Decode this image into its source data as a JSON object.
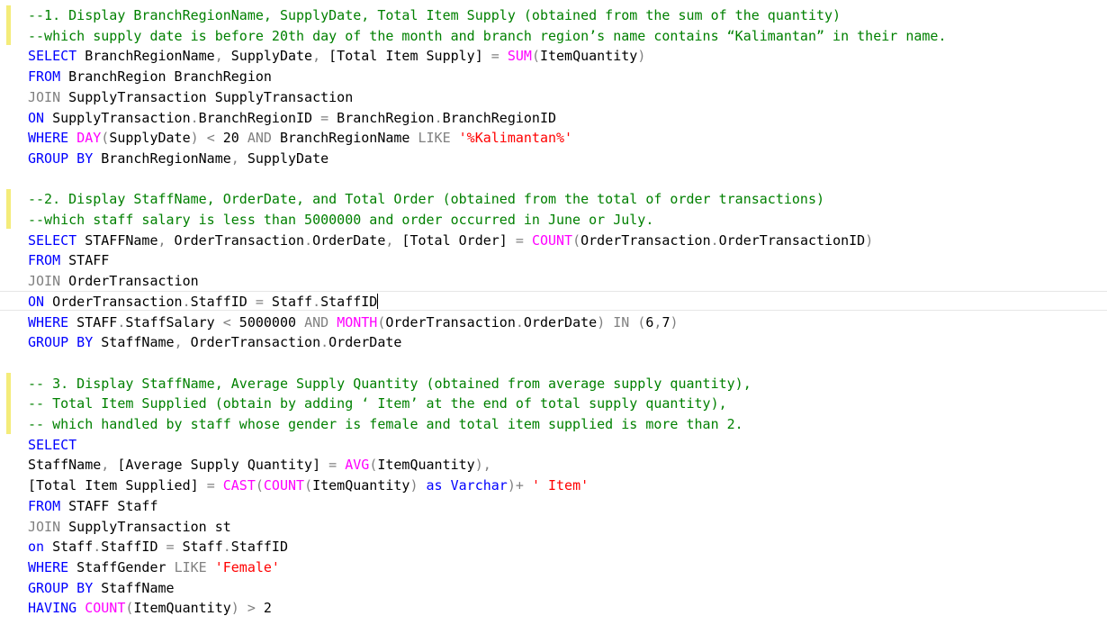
{
  "colors": {
    "keyword": "#0000ff",
    "comment": "#008000",
    "function": "#ff00ff",
    "operator": "#808080",
    "string": "#ff0000",
    "text": "#000000",
    "change_marker": "#f4ec7a"
  },
  "editor": {
    "lines": [
      [
        [
          "cm",
          "--1. Display BranchRegionName, SupplyDate, Total Item Supply (obtained from the sum of the quantity)"
        ]
      ],
      [
        [
          "cm",
          "--which supply date is before 20th day of the month and branch region’s name contains “Kalimantan” in their name."
        ]
      ],
      [
        [
          "kw",
          "SELECT"
        ],
        [
          "tx",
          " BranchRegionName"
        ],
        [
          "op",
          ","
        ],
        [
          "tx",
          " SupplyDate"
        ],
        [
          "op",
          ","
        ],
        [
          "tx",
          " [Total Item Supply] "
        ],
        [
          "op",
          "="
        ],
        [
          "tx",
          " "
        ],
        [
          "fn",
          "SUM"
        ],
        [
          "op",
          "("
        ],
        [
          "tx",
          "ItemQuantity"
        ],
        [
          "op",
          ")"
        ]
      ],
      [
        [
          "kw",
          "FROM"
        ],
        [
          "tx",
          " BranchRegion BranchRegion"
        ]
      ],
      [
        [
          "op",
          "JOIN"
        ],
        [
          "tx",
          " SupplyTransaction SupplyTransaction"
        ]
      ],
      [
        [
          "kw",
          "ON"
        ],
        [
          "tx",
          " SupplyTransaction"
        ],
        [
          "op",
          "."
        ],
        [
          "tx",
          "BranchRegionID "
        ],
        [
          "op",
          "="
        ],
        [
          "tx",
          " BranchRegion"
        ],
        [
          "op",
          "."
        ],
        [
          "tx",
          "BranchRegionID"
        ]
      ],
      [
        [
          "kw",
          "WHERE"
        ],
        [
          "tx",
          " "
        ],
        [
          "fn",
          "DAY"
        ],
        [
          "op",
          "("
        ],
        [
          "tx",
          "SupplyDate"
        ],
        [
          "op",
          ")"
        ],
        [
          "tx",
          " "
        ],
        [
          "op",
          "<"
        ],
        [
          "tx",
          " 20 "
        ],
        [
          "op",
          "AND"
        ],
        [
          "tx",
          " BranchRegionName "
        ],
        [
          "op",
          "LIKE"
        ],
        [
          "tx",
          " "
        ],
        [
          "st",
          "'%Kalimantan%'"
        ]
      ],
      [
        [
          "kw",
          "GROUP BY"
        ],
        [
          "tx",
          " BranchRegionName"
        ],
        [
          "op",
          ","
        ],
        [
          "tx",
          " SupplyDate"
        ]
      ],
      [],
      [
        [
          "cm",
          "--2. Display StaffName, OrderDate, and Total Order (obtained from the total of order transactions)"
        ]
      ],
      [
        [
          "cm",
          "--which staff salary is less than 5000000 and order occurred in June or July."
        ]
      ],
      [
        [
          "kw",
          "SELECT"
        ],
        [
          "tx",
          " STAFFName"
        ],
        [
          "op",
          ","
        ],
        [
          "tx",
          " OrderTransaction"
        ],
        [
          "op",
          "."
        ],
        [
          "tx",
          "OrderDate"
        ],
        [
          "op",
          ","
        ],
        [
          "tx",
          " [Total Order] "
        ],
        [
          "op",
          "="
        ],
        [
          "tx",
          " "
        ],
        [
          "fn",
          "COUNT"
        ],
        [
          "op",
          "("
        ],
        [
          "tx",
          "OrderTransaction"
        ],
        [
          "op",
          "."
        ],
        [
          "tx",
          "OrderTransactionID"
        ],
        [
          "op",
          ")"
        ]
      ],
      [
        [
          "kw",
          "FROM"
        ],
        [
          "tx",
          " STAFF"
        ]
      ],
      [
        [
          "op",
          "JOIN"
        ],
        [
          "tx",
          " OrderTransaction"
        ]
      ],
      [
        [
          "kw",
          "ON"
        ],
        [
          "tx",
          " OrderTransaction"
        ],
        [
          "op",
          "."
        ],
        [
          "tx",
          "StaffID "
        ],
        [
          "op",
          "="
        ],
        [
          "tx",
          " Staff"
        ],
        [
          "op",
          "."
        ],
        [
          "tx",
          "StaffID"
        ]
      ],
      [
        [
          "kw",
          "WHERE"
        ],
        [
          "tx",
          " STAFF"
        ],
        [
          "op",
          "."
        ],
        [
          "tx",
          "StaffSalary "
        ],
        [
          "op",
          "<"
        ],
        [
          "tx",
          " 5000000 "
        ],
        [
          "op",
          "AND"
        ],
        [
          "tx",
          " "
        ],
        [
          "fn",
          "MONTH"
        ],
        [
          "op",
          "("
        ],
        [
          "tx",
          "OrderTransaction"
        ],
        [
          "op",
          "."
        ],
        [
          "tx",
          "OrderDate"
        ],
        [
          "op",
          ")"
        ],
        [
          "tx",
          " "
        ],
        [
          "op",
          "IN"
        ],
        [
          "tx",
          " "
        ],
        [
          "op",
          "("
        ],
        [
          "tx",
          "6"
        ],
        [
          "op",
          ","
        ],
        [
          "tx",
          "7"
        ],
        [
          "op",
          ")"
        ]
      ],
      [
        [
          "kw",
          "GROUP BY"
        ],
        [
          "tx",
          " StaffName"
        ],
        [
          "op",
          ","
        ],
        [
          "tx",
          " OrderTransaction"
        ],
        [
          "op",
          "."
        ],
        [
          "tx",
          "OrderDate"
        ]
      ],
      [],
      [
        [
          "cm",
          "-- 3. Display StaffName, Average Supply Quantity (obtained from average supply quantity),"
        ]
      ],
      [
        [
          "cm",
          "-- Total Item Supplied (obtain by adding ‘ Item’ at the end of total supply quantity),"
        ]
      ],
      [
        [
          "cm",
          "-- which handled by staff whose gender is female and total item supplied is more than 2."
        ]
      ],
      [
        [
          "kw",
          "SELECT"
        ]
      ],
      [
        [
          "tx",
          "StaffName"
        ],
        [
          "op",
          ","
        ],
        [
          "tx",
          " [Average Supply Quantity] "
        ],
        [
          "op",
          "="
        ],
        [
          "tx",
          " "
        ],
        [
          "fn",
          "AVG"
        ],
        [
          "op",
          "("
        ],
        [
          "tx",
          "ItemQuantity"
        ],
        [
          "op",
          "),"
        ]
      ],
      [
        [
          "tx",
          "[Total Item Supplied] "
        ],
        [
          "op",
          "="
        ],
        [
          "tx",
          " "
        ],
        [
          "fn",
          "CAST"
        ],
        [
          "op",
          "("
        ],
        [
          "fn",
          "COUNT"
        ],
        [
          "op",
          "("
        ],
        [
          "tx",
          "ItemQuantity"
        ],
        [
          "op",
          ")"
        ],
        [
          "tx",
          " "
        ],
        [
          "kw",
          "as"
        ],
        [
          "tx",
          " "
        ],
        [
          "kw",
          "Varchar"
        ],
        [
          "op",
          ")+"
        ],
        [
          "tx",
          " "
        ],
        [
          "st",
          "' Item'"
        ]
      ],
      [
        [
          "kw",
          "FROM"
        ],
        [
          "tx",
          " STAFF Staff"
        ]
      ],
      [
        [
          "op",
          "JOIN"
        ],
        [
          "tx",
          " SupplyTransaction st"
        ]
      ],
      [
        [
          "kw",
          "on"
        ],
        [
          "tx",
          " Staff"
        ],
        [
          "op",
          "."
        ],
        [
          "tx",
          "StaffID "
        ],
        [
          "op",
          "="
        ],
        [
          "tx",
          " Staff"
        ],
        [
          "op",
          "."
        ],
        [
          "tx",
          "StaffID"
        ]
      ],
      [
        [
          "kw",
          "WHERE"
        ],
        [
          "tx",
          " StaffGender "
        ],
        [
          "op",
          "LIKE"
        ],
        [
          "tx",
          " "
        ],
        [
          "st",
          "'Female'"
        ]
      ],
      [
        [
          "kw",
          "GROUP BY"
        ],
        [
          "tx",
          " StaffName"
        ]
      ],
      [
        [
          "kw",
          "HAVING"
        ],
        [
          "tx",
          " "
        ],
        [
          "fn",
          "COUNT"
        ],
        [
          "op",
          "("
        ],
        [
          "tx",
          "ItemQuantity"
        ],
        [
          "op",
          ")"
        ],
        [
          "tx",
          " "
        ],
        [
          "op",
          ">"
        ],
        [
          "tx",
          " 2"
        ]
      ]
    ]
  }
}
